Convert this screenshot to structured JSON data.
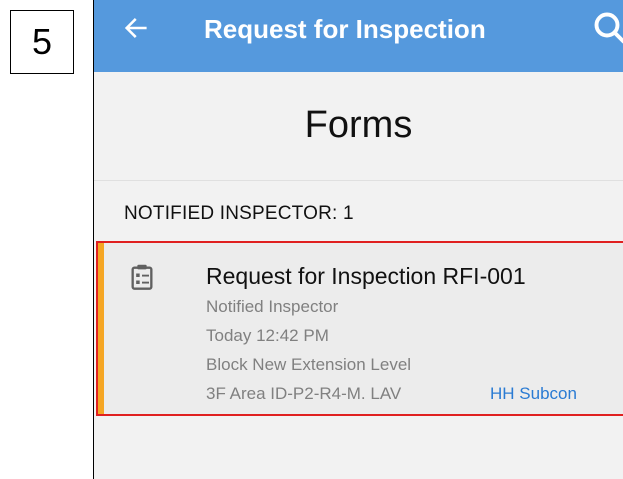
{
  "step": {
    "number": "5"
  },
  "appbar": {
    "title": "Request for Inspection",
    "back_icon": "arrow-left-icon",
    "search_icon": "search-icon",
    "color": "#5599dd"
  },
  "page": {
    "title": "Forms"
  },
  "section": {
    "header": "NOTIFIED INSPECTOR: 1"
  },
  "form_item": {
    "icon": "clipboard-icon",
    "title": "Request for Inspection RFI-001",
    "status": "Notified Inspector",
    "time": "Today 12:42 PM",
    "location_line1": "Block New Extension Level",
    "location_line2": "3F Area ID-P2-R4-M. LAV",
    "assignee": "HH Subcon",
    "accent_color": "#f5a623",
    "highlight_color": "#e02020"
  }
}
